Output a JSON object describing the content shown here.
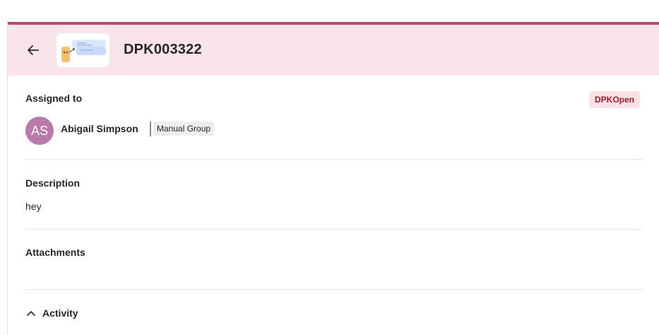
{
  "ticket": {
    "id": "DPK003322",
    "status": "DPKOpen"
  },
  "assigned": {
    "label": "Assigned to",
    "avatar_initials": "AS",
    "name": "Abigail Simpson",
    "group": "Manual Group"
  },
  "description": {
    "label": "Description",
    "text": "hey"
  },
  "attachments": {
    "label": "Attachments"
  },
  "activity": {
    "label": "Activity"
  },
  "colors": {
    "accent": "#b94a6a",
    "header_bg": "#f9e5e9",
    "badge_bg": "#fbe2e4",
    "badge_text": "#9a1d2a",
    "avatar_bg": "#b97aa9"
  },
  "icons": {
    "back": "arrow-left-icon",
    "thumbnail": "ticket-illustration",
    "activity_toggle": "chevron-up-icon"
  }
}
